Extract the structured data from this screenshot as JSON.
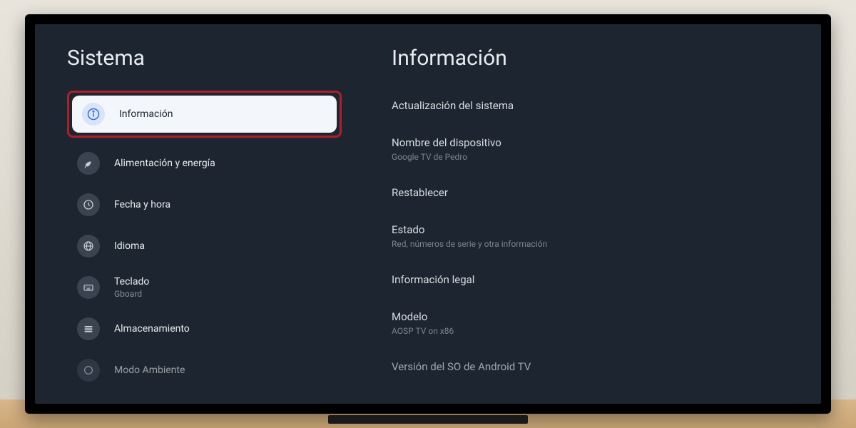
{
  "left": {
    "title": "Sistema",
    "items": [
      {
        "label": "Información",
        "icon": "info"
      },
      {
        "label": "Alimentación y energía",
        "icon": "leaf"
      },
      {
        "label": "Fecha y hora",
        "icon": "clock"
      },
      {
        "label": "Idioma",
        "icon": "globe"
      },
      {
        "label": "Teclado",
        "sublabel": "Gboard",
        "icon": "keyboard"
      },
      {
        "label": "Almacenamiento",
        "icon": "storage"
      },
      {
        "label": "Modo Ambiente",
        "icon": "circle"
      }
    ]
  },
  "right": {
    "title": "Información",
    "items": [
      {
        "label": "Actualización del sistema"
      },
      {
        "label": "Nombre del dispositivo",
        "sublabel": "Google TV de Pedro"
      },
      {
        "label": "Restablecer"
      },
      {
        "label": "Estado",
        "sublabel": "Red, números de serie y otra información"
      },
      {
        "label": "Información legal"
      },
      {
        "label": "Modelo",
        "sublabel": "AOSP TV on x86"
      },
      {
        "label": "Versión del SO de Android TV"
      }
    ]
  }
}
